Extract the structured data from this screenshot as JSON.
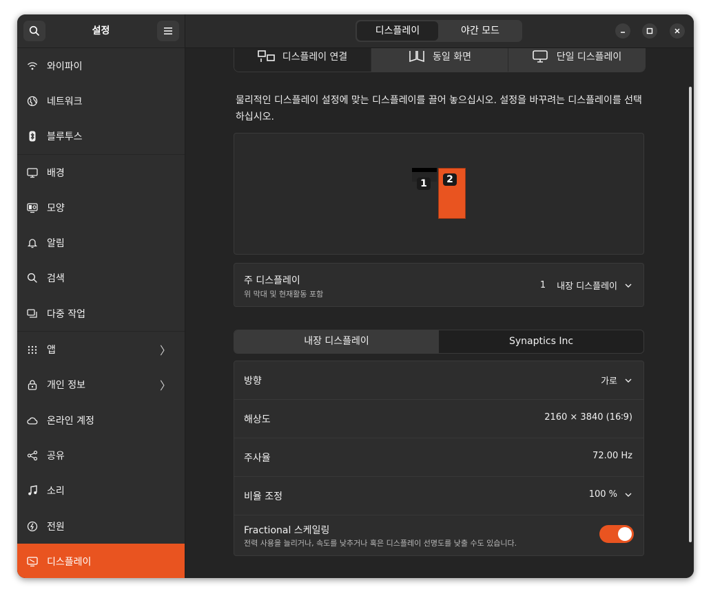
{
  "sidebar": {
    "title": "설정",
    "items": [
      {
        "label": "와이파이",
        "icon": "wifi-icon"
      },
      {
        "label": "네트워크",
        "icon": "network-icon"
      },
      {
        "label": "블루투스",
        "icon": "bluetooth-icon"
      },
      {
        "label": "배경",
        "icon": "background-icon"
      },
      {
        "label": "모양",
        "icon": "appearance-icon"
      },
      {
        "label": "알림",
        "icon": "bell-icon"
      },
      {
        "label": "검색",
        "icon": "search-icon"
      },
      {
        "label": "다중 작업",
        "icon": "multitasking-icon"
      },
      {
        "label": "앱",
        "icon": "apps-grid-icon"
      },
      {
        "label": "개인 정보",
        "icon": "lock-icon"
      },
      {
        "label": "온라인 계정",
        "icon": "cloud-icon"
      },
      {
        "label": "공유",
        "icon": "share-icon"
      },
      {
        "label": "소리",
        "icon": "music-note-icon"
      },
      {
        "label": "전원",
        "icon": "power-icon"
      },
      {
        "label": "디스플레이",
        "icon": "display-icon"
      }
    ]
  },
  "header": {
    "tabs": [
      "디스플레이",
      "야간 모드"
    ],
    "active_tab": "디스플레이"
  },
  "display_modes": [
    {
      "label": "디스플레이 연결",
      "icon": "join-displays-icon"
    },
    {
      "label": "동일 화면",
      "icon": "mirror-icon"
    },
    {
      "label": "단일 디스플레이",
      "icon": "single-display-icon"
    }
  ],
  "instructions": "물리적인 디스플레이 설정에 맞는 디스플레이를 끌어 놓으십시오. 설정을 바꾸려는 디스플레이를 선택하십시오.",
  "arrangement": {
    "monitor_1": "1",
    "monitor_2": "2"
  },
  "primary_display": {
    "title": "주 디스플레이",
    "subtitle": "위 막대 및 현재활동 포함",
    "value_number": "1",
    "value_name": "내장 디스플레이"
  },
  "monitor_tabs": [
    "내장 디스플레이",
    "Synaptics Inc"
  ],
  "settings": {
    "orientation": {
      "label": "방향",
      "value": "가로"
    },
    "resolution": {
      "label": "해상도",
      "value": "2160 × 3840 (16∶9)"
    },
    "refresh_rate": {
      "label": "주사율",
      "value": "72.00 Hz"
    },
    "scale": {
      "label": "비율 조정",
      "value": "100 %"
    },
    "fractional": {
      "label": "Fractional 스케일링",
      "subtitle": "전력 사용을 늘리거나, 속도를 낮추거나 혹은 디스플레이 선명도를 낮출 수도 있습니다.",
      "enabled": true
    }
  },
  "colors": {
    "accent": "#e95420",
    "window_bg": "#242424",
    "sidebar_bg": "#2e2e2e"
  }
}
